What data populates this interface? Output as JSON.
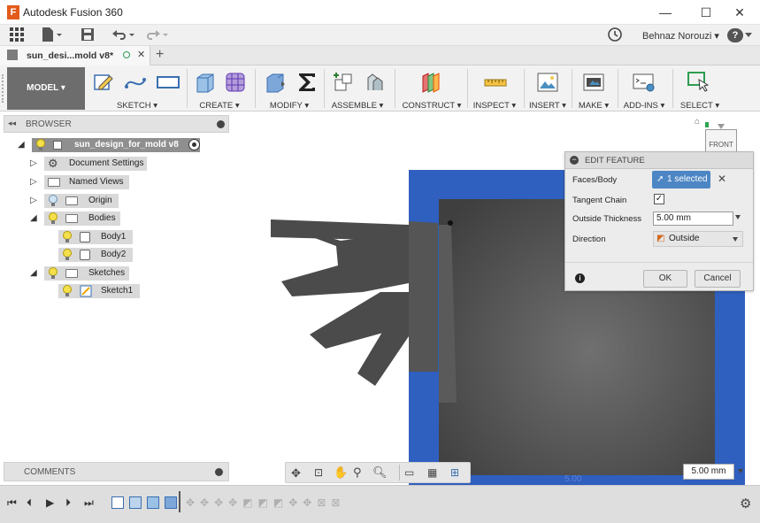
{
  "app": {
    "title": "Autodesk Fusion 360",
    "logo_letter": "F",
    "user_name": "Behnaz Norouzi ▾",
    "help_label": "?",
    "window_controls": {
      "minimize": "—",
      "maximize": "☐",
      "close": "✕"
    }
  },
  "document_tab": {
    "name": "sun_desi...mold v8*",
    "close": "✕",
    "add": "+"
  },
  "toolbar": {
    "workspace": "MODEL ▾",
    "groups": [
      {
        "label": "SKETCH ▾"
      },
      {
        "label": "CREATE ▾"
      },
      {
        "label": "MODIFY ▾"
      },
      {
        "label": "ASSEMBLE ▾"
      },
      {
        "label": "CONSTRUCT ▾"
      },
      {
        "label": "INSPECT ▾"
      },
      {
        "label": "INSERT ▾"
      },
      {
        "label": "MAKE ▾"
      },
      {
        "label": "ADD-INS ▾"
      },
      {
        "label": "SELECT ▾"
      }
    ]
  },
  "browser": {
    "title": "BROWSER",
    "items": [
      {
        "label": "sun_design_for_mold v8"
      },
      {
        "label": "Document Settings"
      },
      {
        "label": "Named Views"
      },
      {
        "label": "Origin"
      },
      {
        "label": "Bodies"
      },
      {
        "label": "Body1"
      },
      {
        "label": "Body2"
      },
      {
        "label": "Sketches"
      },
      {
        "label": "Sketch1"
      }
    ]
  },
  "comments": {
    "title": "COMMENTS"
  },
  "edit_feature": {
    "title": "EDIT FEATURE",
    "faces_body_label": "Faces/Body",
    "faces_body_value": "1 selected",
    "tangent_chain_label": "Tangent Chain",
    "outside_thickness_label": "Outside Thickness",
    "outside_thickness_value": "5.00 mm",
    "direction_label": "Direction",
    "direction_value": "Outside",
    "ok_label": "OK",
    "cancel_label": "Cancel"
  },
  "viewcube": {
    "face": "FRONT"
  },
  "viewport": {
    "dimension_value": "5.00 mm",
    "canvas_label": "5.00"
  },
  "colors": {
    "shell_blue": "#2f5fbf",
    "body_dark": "#4b4b4b",
    "selected_blue": "#4d86c4",
    "toolbar_bg": "#f2f2f2"
  }
}
